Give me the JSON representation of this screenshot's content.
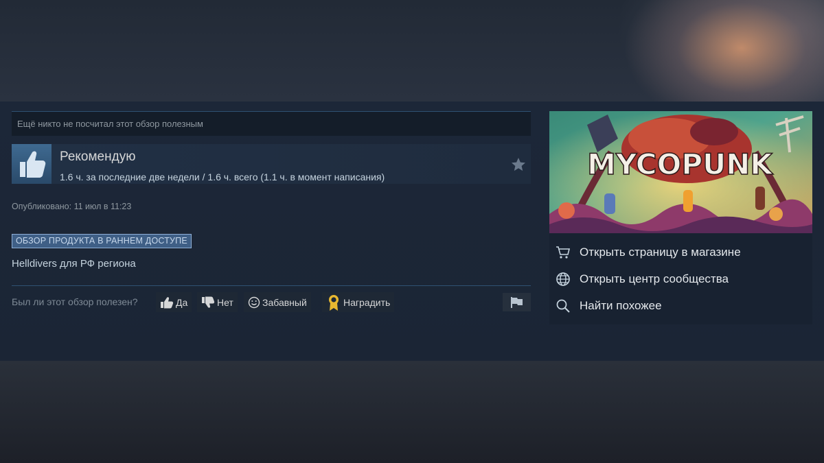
{
  "review": {
    "helpful_notice": "Ещё никто не посчитал этот обзор полезным",
    "recommendation": "Рекомендую",
    "hours": "1.6 ч. за последние две недели / 1.6 ч. всего (1.1 ч. в момент написания)",
    "posted": "Опубликовано: 11 июл в 11:23",
    "early_access_badge": "ОБЗОР ПРОДУКТА В РАННЕМ ДОСТУПЕ",
    "text": "Helldivers для РФ региона"
  },
  "feedback": {
    "question": "Был ли этот обзор полезен?",
    "yes": "Да",
    "no": "Нет",
    "funny": "Забавный",
    "award": "Наградить"
  },
  "game": {
    "logo_text": "MYCOPUNK"
  },
  "links": {
    "store": "Открыть страницу в магазине",
    "community": "Открыть центр сообщества",
    "similar": "Найти похожее"
  },
  "icons": {
    "thumb": "thumbs-up-icon",
    "star": "star-icon",
    "flag": "flag-icon",
    "cart": "cart-icon",
    "globe": "globe-icon",
    "search": "search-icon"
  },
  "colors": {
    "accent_blue": "#3f6a91",
    "badge_bg": "#3f5f86",
    "award_gold": "#e8b830"
  }
}
